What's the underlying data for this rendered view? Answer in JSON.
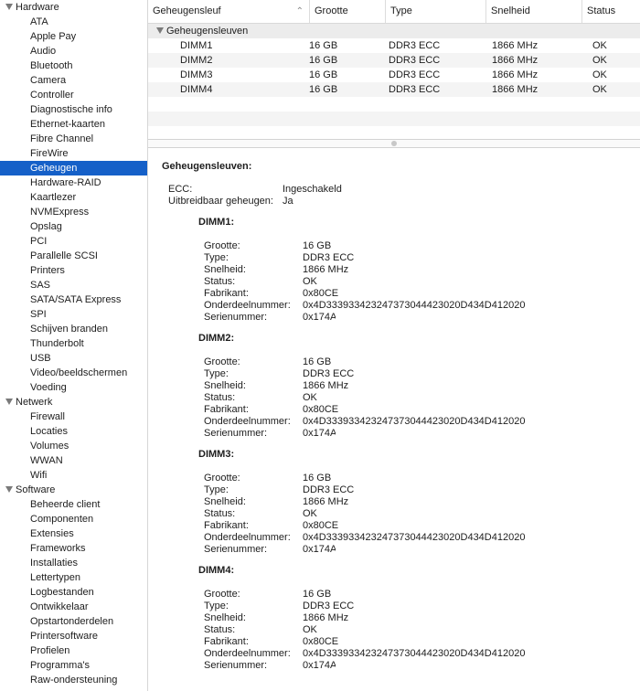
{
  "sidebar": {
    "groups": [
      {
        "label": "Hardware",
        "items": [
          "ATA",
          "Apple Pay",
          "Audio",
          "Bluetooth",
          "Camera",
          "Controller",
          "Diagnostische info",
          "Ethernet-kaarten",
          "Fibre Channel",
          "FireWire",
          "Geheugen",
          "Hardware-RAID",
          "Kaartlezer",
          "NVMExpress",
          "Opslag",
          "PCI",
          "Parallelle SCSI",
          "Printers",
          "SAS",
          "SATA/SATA Express",
          "SPI",
          "Schijven branden",
          "Thunderbolt",
          "USB",
          "Video/beeldschermen",
          "Voeding"
        ]
      },
      {
        "label": "Netwerk",
        "items": [
          "Firewall",
          "Locaties",
          "Volumes",
          "WWAN",
          "Wifi"
        ]
      },
      {
        "label": "Software",
        "items": [
          "Beheerde client",
          "Componenten",
          "Extensies",
          "Frameworks",
          "Installaties",
          "Lettertypen",
          "Logbestanden",
          "Ontwikkelaar",
          "Opstartonderdelen",
          "Printersoftware",
          "Profielen",
          "Programma's",
          "Raw-ondersteuning"
        ]
      }
    ],
    "selected": "Geheugen"
  },
  "table": {
    "headers": [
      "Geheugensleuf",
      "Grootte",
      "Type",
      "Snelheid",
      "Status"
    ],
    "group_label": "Geheugensleuven",
    "rows": [
      [
        "DIMM1",
        "16 GB",
        "DDR3 ECC",
        "1866 MHz",
        "OK"
      ],
      [
        "DIMM2",
        "16 GB",
        "DDR3 ECC",
        "1866 MHz",
        "OK"
      ],
      [
        "DIMM3",
        "16 GB",
        "DDR3 ECC",
        "1866 MHz",
        "OK"
      ],
      [
        "DIMM4",
        "16 GB",
        "DDR3 ECC",
        "1866 MHz",
        "OK"
      ]
    ]
  },
  "detail": {
    "title": "Geheugensleuven:",
    "ecc_label": "ECC:",
    "ecc_value": "Ingeschakeld",
    "upgradeable_label": "Uitbreidbaar geheugen:",
    "upgradeable_value": "Ja",
    "field_labels": [
      "Grootte:",
      "Type:",
      "Snelheid:",
      "Status:",
      "Fabrikant:",
      "Onderdeelnummer:",
      "Serienummer:"
    ],
    "dimms": [
      {
        "title": "DIMM1:",
        "values": [
          "16 GB",
          "DDR3 ECC",
          "1866 MHz",
          "OK",
          "0x80CE",
          "0x4D333933423247373044423020D434D412020",
          "0x174A"
        ]
      },
      {
        "title": "DIMM2:",
        "values": [
          "16 GB",
          "DDR3 ECC",
          "1866 MHz",
          "OK",
          "0x80CE",
          "0x4D333933423247373044423020D434D412020",
          "0x174A"
        ]
      },
      {
        "title": "DIMM3:",
        "values": [
          "16 GB",
          "DDR3 ECC",
          "1866 MHz",
          "OK",
          "0x80CE",
          "0x4D333933423247373044423020D434D412020",
          "0x174A"
        ]
      },
      {
        "title": "DIMM4:",
        "values": [
          "16 GB",
          "DDR3 ECC",
          "1866 MHz",
          "OK",
          "0x80CE",
          "0x4D333933423247373044423020D434D412020",
          "0x174A"
        ]
      }
    ]
  },
  "colors": {
    "selection": "#1560c8",
    "group_row": "#ececec",
    "alt_row": "#f4f4f4"
  }
}
